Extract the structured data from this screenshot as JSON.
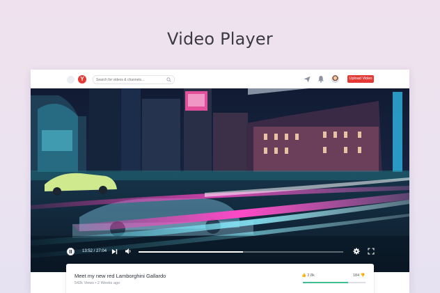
{
  "page": {
    "title": "Video Player"
  },
  "header": {
    "logo_letter": "Y",
    "search_placeholder": "Search for videos & channels...",
    "upload_label": "Upload Video",
    "brand_color": "#e53935",
    "icons": [
      "menu-icon",
      "search-icon",
      "send-icon",
      "bell-icon"
    ]
  },
  "player": {
    "current_time": "13:52",
    "duration": "27:04",
    "time_label": "13:52 / 27:04",
    "progress_fraction": 0.51,
    "icons": [
      "pause-icon",
      "skip-next-icon",
      "volume-icon",
      "gear-icon",
      "fullscreen-icon"
    ]
  },
  "video_info": {
    "title": "Meet my new red Lamborghini Gallardo",
    "meta": "542k Views • 2 Weeks ago",
    "likes": "2.8k",
    "dislikes": "184",
    "like_fraction": 0.72,
    "rating_color": "#3fbf8f"
  }
}
